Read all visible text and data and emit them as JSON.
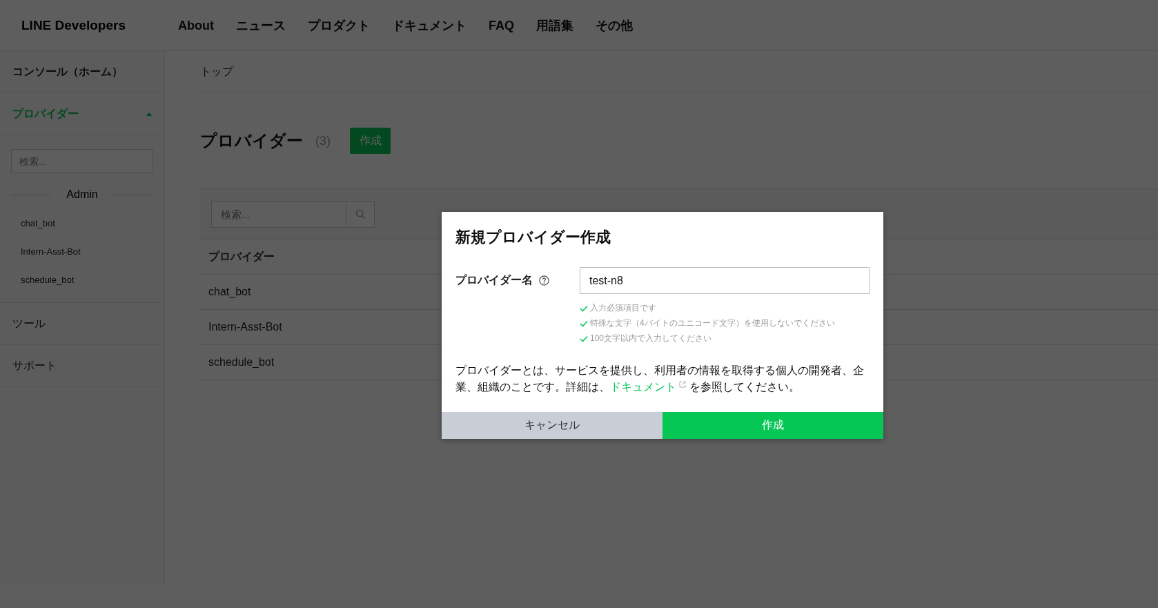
{
  "header": {
    "logo": "LINE Developers",
    "nav": [
      "About",
      "ニュース",
      "プロダクト",
      "ドキュメント",
      "FAQ",
      "用語集",
      "その他"
    ]
  },
  "sidebar": {
    "items": [
      {
        "kind": "link",
        "label": "コンソール（ホーム）",
        "selected": false
      },
      {
        "kind": "section",
        "label": "プロバイダー",
        "selected": true,
        "expanded": true,
        "search_placeholder": "検索...",
        "group": "Admin",
        "children": [
          "chat_bot",
          "Intern-Asst-Bot",
          "schedule_bot"
        ]
      },
      {
        "kind": "link",
        "label": "ツール",
        "selected": false
      },
      {
        "kind": "link",
        "label": "サポート",
        "selected": false
      }
    ]
  },
  "breadcrumb": "トップ",
  "page": {
    "title": "プロバイダー",
    "count": "(3)",
    "create_button": "作成"
  },
  "table": {
    "search_placeholder": "検索...",
    "columns": [
      "プロバイダー"
    ],
    "rows": [
      "chat_bot",
      "Intern-Asst-Bot",
      "schedule_bot"
    ]
  },
  "modal": {
    "title": "新規プロバイダー作成",
    "field_label": "プロバイダー名",
    "value": "test-n8",
    "validations": [
      {
        "text": "入力必須項目です",
        "ok": true
      },
      {
        "text": "特殊な文字（4バイトのユニコード文字）を使用しないでください",
        "ok": true
      },
      {
        "text": "100文字以内で入力してください",
        "ok": true
      }
    ],
    "description": {
      "before": "プロバイダーとは、サービスを提供し、利用者の情報を取得する個人の開発者、企業、組織のことです。詳細は、",
      "link": "ドキュメント",
      "after": " を参照してください。"
    },
    "cancel_button": "キャンセル",
    "submit_button": "作成"
  }
}
